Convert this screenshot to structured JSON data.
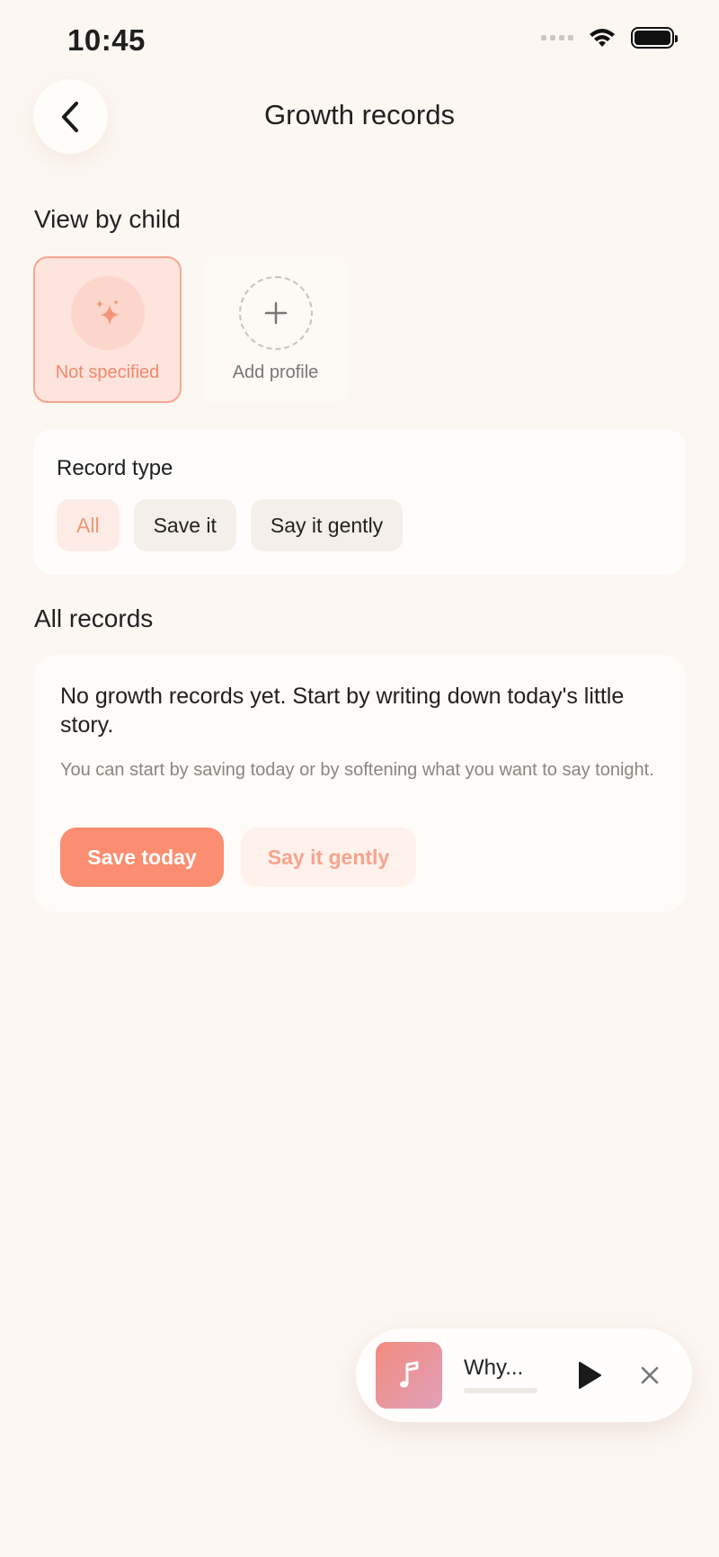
{
  "status_bar": {
    "time": "10:45"
  },
  "header": {
    "title": "Growth records"
  },
  "children": {
    "section_title": "View by child",
    "items": [
      {
        "label": "Not specified",
        "selected": true
      },
      {
        "label": "Add profile",
        "selected": false
      }
    ]
  },
  "record_type": {
    "title": "Record type",
    "chips": [
      {
        "label": "All",
        "active": true
      },
      {
        "label": "Save it",
        "active": false
      },
      {
        "label": "Say it gently",
        "active": false
      }
    ]
  },
  "records": {
    "section_title": "All records",
    "empty_title": "No growth records yet. Start by writing down today's little story.",
    "empty_subtitle": "You can start by saving today or by softening what you want to say tonight.",
    "primary_button": "Save today",
    "secondary_button": "Say it gently"
  },
  "player": {
    "track_title": "Why...",
    "progress": 0
  },
  "colors": {
    "background": "#fdf7f2",
    "accent": "#fb8d70",
    "accent_soft": "#fde4dc",
    "chip_inactive": "#f5efe9"
  }
}
